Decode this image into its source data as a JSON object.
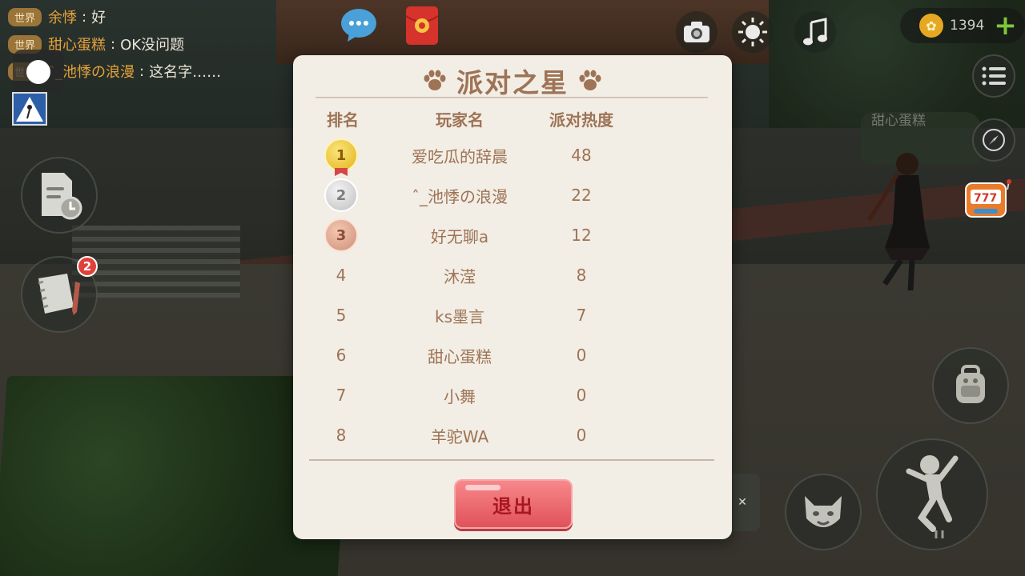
{
  "chat": {
    "messages": [
      {
        "channel": "世界",
        "sender": "余悸",
        "separator": ":",
        "text": "好"
      },
      {
        "channel": "世界",
        "sender": "甜心蛋糕",
        "separator": ":",
        "text": "OK没问题"
      },
      {
        "channel": "世界",
        "sender": "ˆ_池悸の浪漫",
        "separator": ":",
        "text": "这名字……"
      }
    ]
  },
  "scene": {
    "npc_name": "甜心蛋糕"
  },
  "hud": {
    "coins": "1394",
    "coin_plus": "+",
    "mail_badge": "2"
  },
  "modal": {
    "title": "派对之星",
    "columns": {
      "rank": "排名",
      "name": "玩家名",
      "heat": "派对热度"
    },
    "rows": [
      {
        "rank": "1",
        "medal": "gold",
        "name": "爱吃瓜的辞晨",
        "heat": "48"
      },
      {
        "rank": "2",
        "medal": "silver",
        "name": "ˆ_池悸の浪漫",
        "heat": "22"
      },
      {
        "rank": "3",
        "medal": "bronze",
        "name": "好无聊a",
        "heat": "12"
      },
      {
        "rank": "4",
        "medal": "",
        "name": "沐滢",
        "heat": "8"
      },
      {
        "rank": "5",
        "medal": "",
        "name": "ks墨言",
        "heat": "7"
      },
      {
        "rank": "6",
        "medal": "",
        "name": "甜心蛋糕",
        "heat": "0"
      },
      {
        "rank": "7",
        "medal": "",
        "name": "小舞",
        "heat": "0"
      },
      {
        "rank": "8",
        "medal": "",
        "name": "羊驼WA",
        "heat": "0"
      }
    ],
    "exit_label": "退出"
  },
  "colors": {
    "modal_bg": "#f2eee5",
    "title_brown": "#9e7356",
    "exit_red": "#e0525a",
    "chat_name": "#e5a23a"
  }
}
